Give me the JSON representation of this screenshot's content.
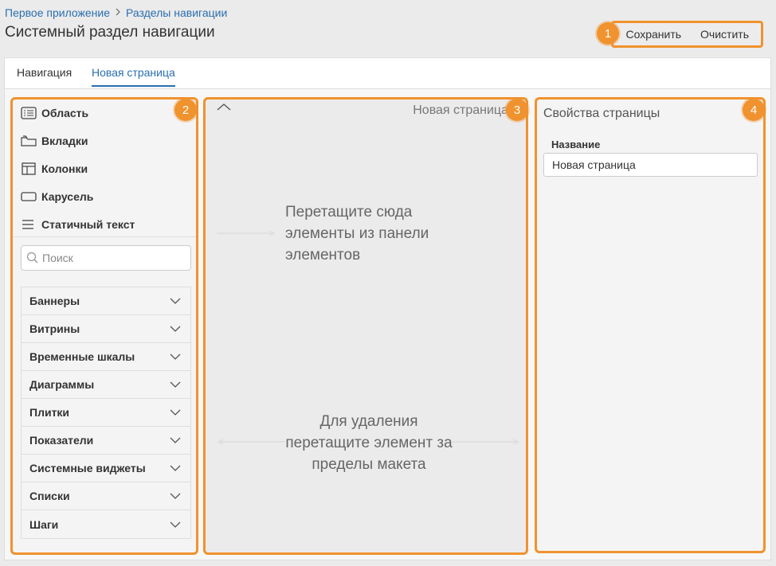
{
  "breadcrumb": {
    "items": [
      "Первое приложение",
      "Разделы навигации"
    ],
    "separator": ">"
  },
  "page_title": "Системный раздел навигации",
  "toolbar": {
    "save_label": "Сохранить",
    "clear_label": "Очистить"
  },
  "badges": [
    "1",
    "2",
    "3",
    "4"
  ],
  "tabs": [
    {
      "label": "Навигация",
      "active": false
    },
    {
      "label": "Новая страница",
      "active": true
    }
  ],
  "elements": {
    "items": [
      {
        "label": "Область",
        "icon": "list-icon"
      },
      {
        "label": "Вкладки",
        "icon": "folder-tabs-icon"
      },
      {
        "label": "Колонки",
        "icon": "columns-icon"
      },
      {
        "label": "Карусель",
        "icon": "carousel-icon"
      },
      {
        "label": "Статичный текст",
        "icon": "text-lines-icon"
      }
    ],
    "search_placeholder": "Поиск",
    "groups": [
      "Баннеры",
      "Витрины",
      "Временные шкалы",
      "Диаграммы",
      "Плитки",
      "Показатели",
      "Системные виджеты",
      "Списки",
      "Шаги"
    ]
  },
  "canvas": {
    "title": "Новая страница",
    "drop_hint": "Перетащите сюда элементы из панели элементов",
    "delete_hint": "Для удаления перетащите элемент за пределы макета"
  },
  "properties": {
    "title": "Свойства страницы",
    "field_label": "Название",
    "field_value": "Новая страница"
  },
  "colors": {
    "accent": "#f0922e",
    "link": "#2a6fb0",
    "background": "#ebebeb"
  }
}
